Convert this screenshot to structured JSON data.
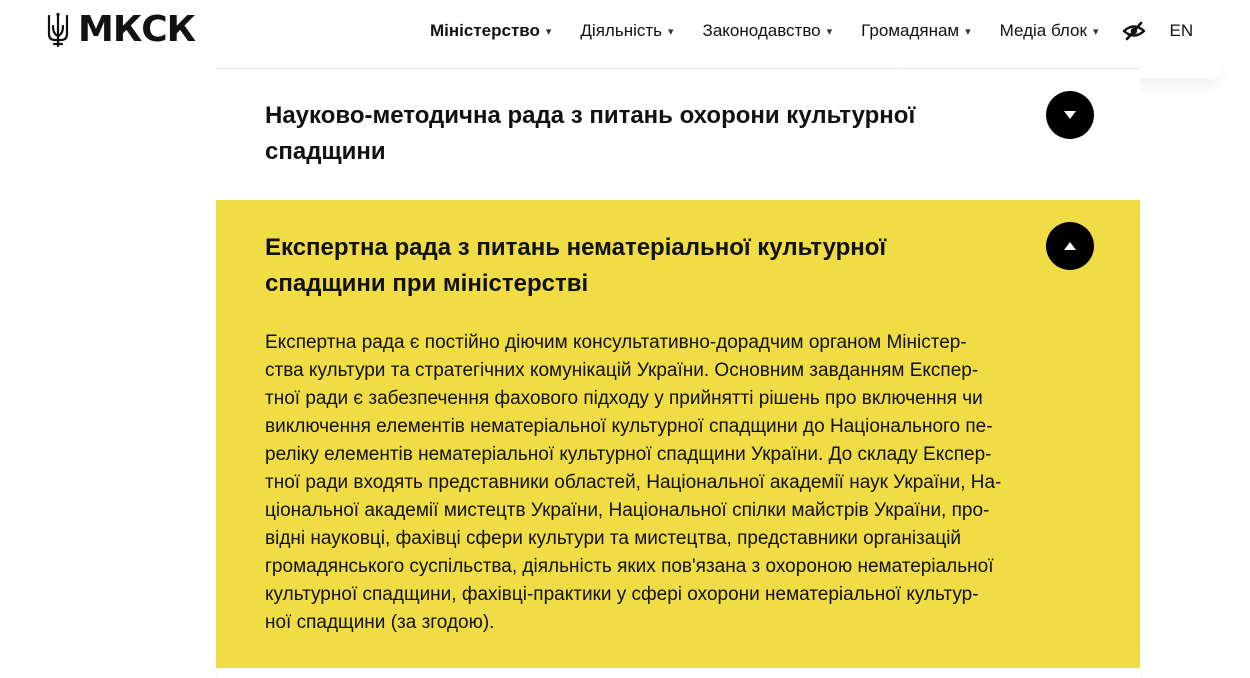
{
  "header": {
    "logo_text": "МКСК",
    "nav": [
      {
        "label": "Міністерство"
      },
      {
        "label": "Діяльність"
      },
      {
        "label": "Законодавство"
      },
      {
        "label": "Громадянам"
      },
      {
        "label": "Медіа блок"
      }
    ],
    "lang": "EN"
  },
  "accordion": [
    {
      "title_lines": [
        "Науково-методична рада з питань охорони культурної",
        "спадщини"
      ],
      "expanded": false,
      "toggle_icon": "chevron-down-icon"
    },
    {
      "title_lines": [
        "Експертна рада з питань нематеріальної культурної",
        "спадщини при міністерстві"
      ],
      "expanded": true,
      "toggle_icon": "chevron-up-icon",
      "accent_color": "#f0dc45",
      "body_lines": [
        "Експертна рада є постійно діючим консультативно-дорадчим органом Міністер-",
        "ства культури та стратегічних комунікацій України. Основним завданням Експер-",
        "тної ради є забезпечення фахового підходу у прийнятті рішень про включення чи",
        "виключення елементів нематеріальної культурної спадщини до Національного пе-",
        "реліку елементів нематеріальної культурної спадщини України. До складу Експер-",
        "тної ради входять представники областей, Національної академії наук України, На-",
        "ціональної академії мистецтв України, Національної спілки майстрів України, про-",
        "відні науковці, фахівці сфери культури та мистецтва, представники організацій",
        "громадянського суспільства, діяльність яких пов'язана з охороною нематеріальної",
        "культурної спадщини, фахівці-практики у сфері охорони нематеріальної культур-",
        "ної спадщини (за згодою)."
      ]
    }
  ]
}
